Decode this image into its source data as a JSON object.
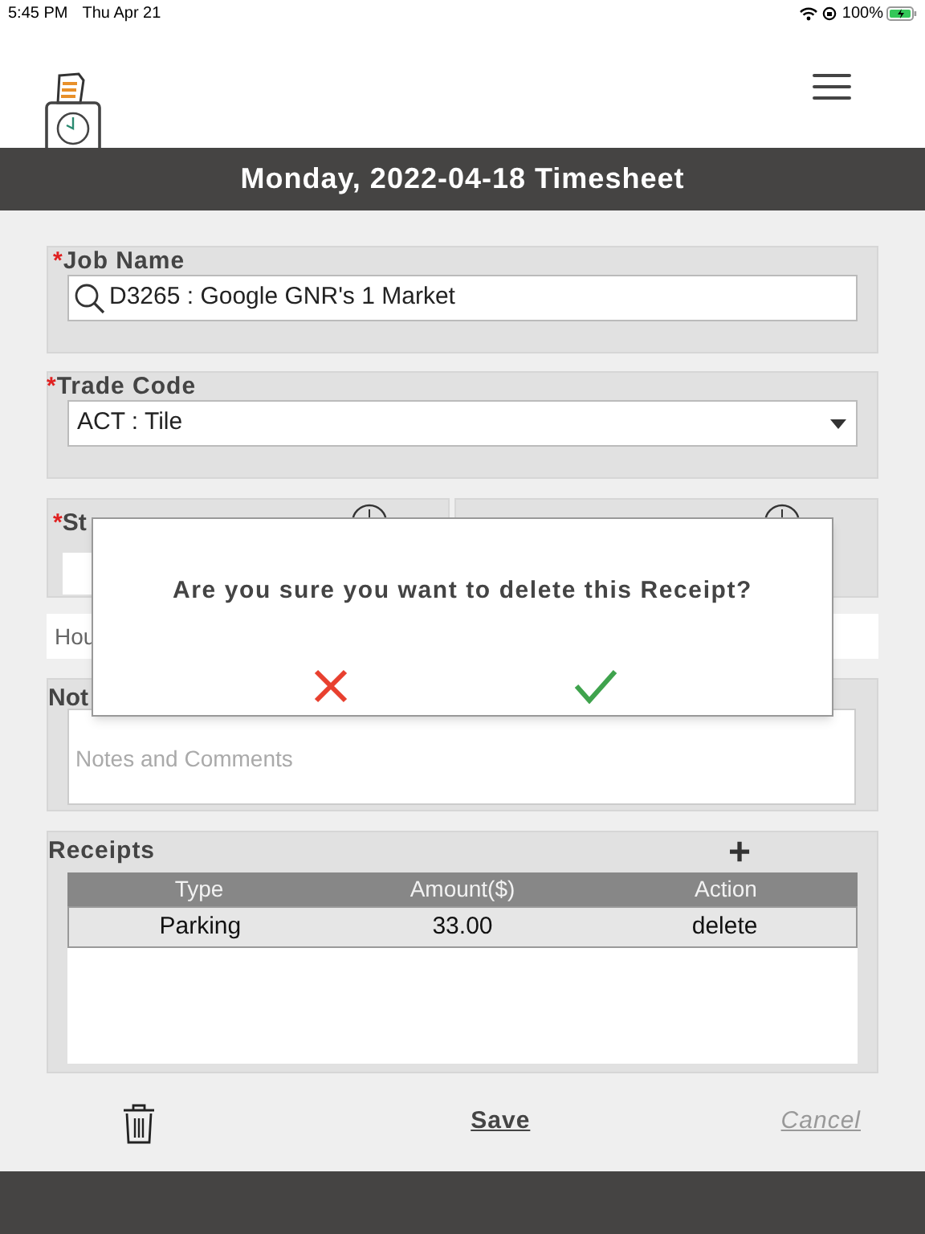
{
  "status_bar": {
    "time": "5:45 PM",
    "date": "Thu Apr 21",
    "battery": "100%"
  },
  "title": "Monday, 2022-04-18 Timesheet",
  "job_name": {
    "required_mark": "*",
    "label": "Job Name",
    "value": "D3265 : Google GNR's 1 Market"
  },
  "trade_code": {
    "required_mark": "*",
    "label": "Trade Code",
    "value": "ACT : Tile"
  },
  "start_time": {
    "required_mark": "*",
    "label": "St"
  },
  "hours": {
    "placeholder": "Hou"
  },
  "notes": {
    "label": "Not",
    "placeholder": "Notes and Comments"
  },
  "receipts": {
    "label": "Receipts",
    "add": "+",
    "columns": [
      "Type",
      "Amount($)",
      "Action"
    ],
    "rows": [
      {
        "type": "Parking",
        "amount": "33.00",
        "action": "delete"
      }
    ]
  },
  "footer": {
    "save": "Save",
    "cancel": "Cancel"
  },
  "dialog": {
    "message": "Are you sure you want to delete this Receipt?"
  }
}
